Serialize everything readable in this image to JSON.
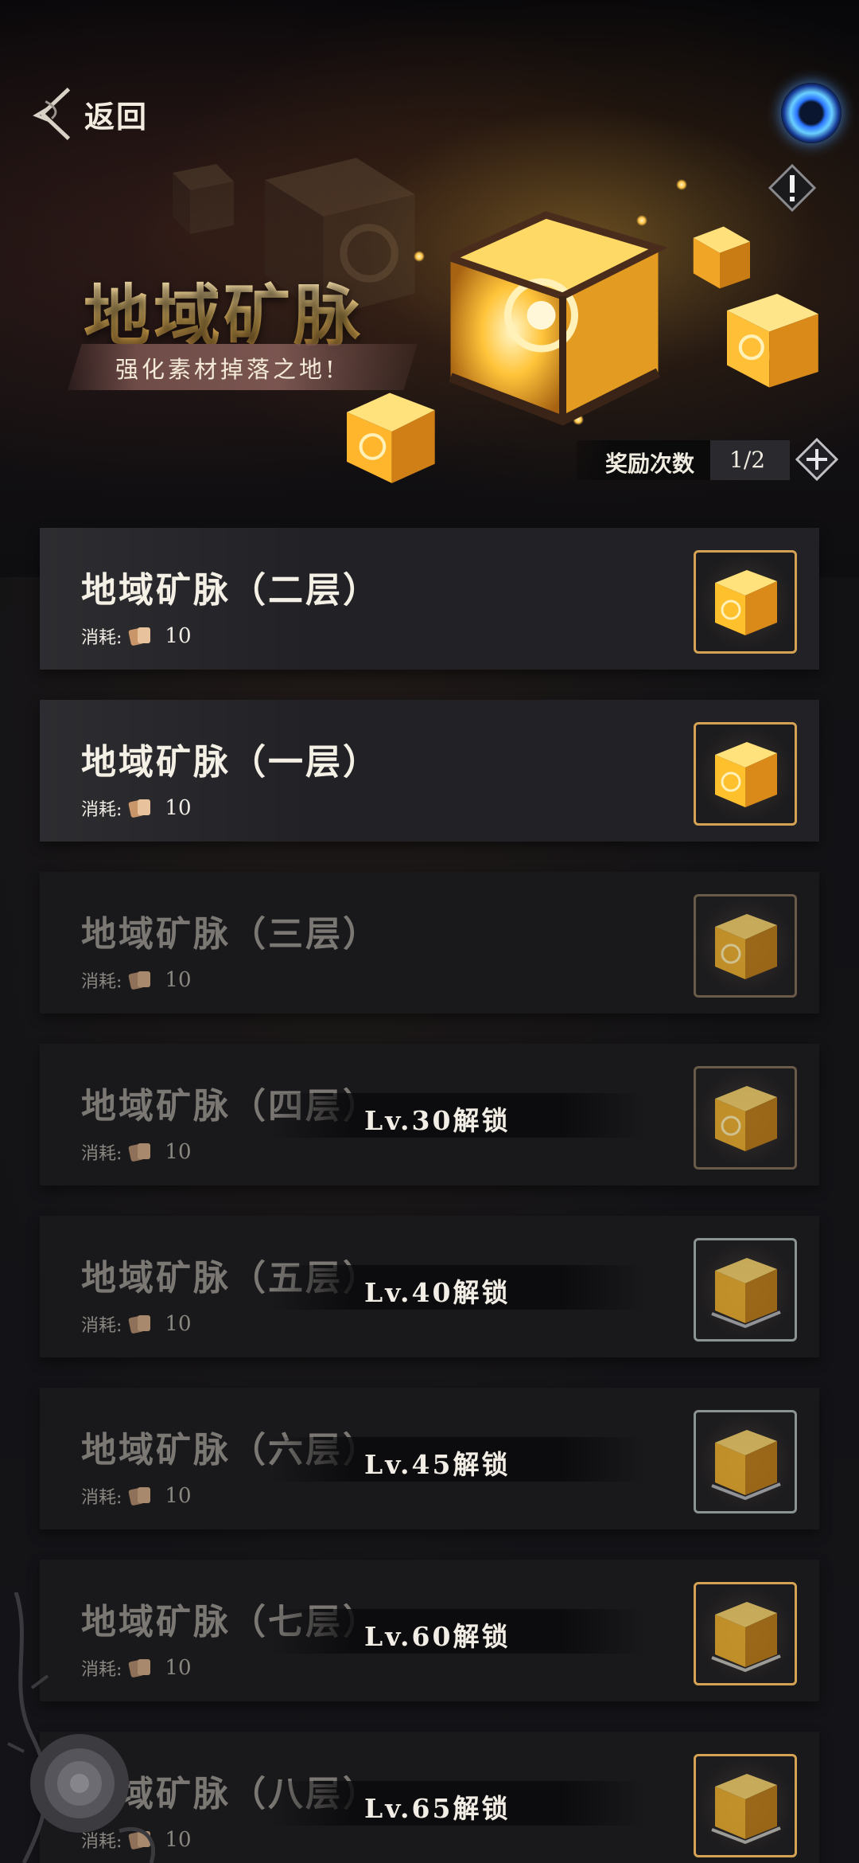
{
  "header": {
    "back_label": "返回",
    "title": "地域矿脉",
    "subtitle": "强化素材掉落之地!"
  },
  "reward": {
    "label": "奖励次数",
    "value": "1/2"
  },
  "colors": {
    "gold_text": "#e2b45a",
    "card_bg": "#1f1f23",
    "frame_gold": "#c79661",
    "page_bg": "#111114"
  },
  "dungeons": [
    {
      "name": "地域矿脉（二层）",
      "cost_label": "消耗:",
      "cost_value": "10",
      "lock_text": ""
    },
    {
      "name": "地域矿脉（一层）",
      "cost_label": "消耗:",
      "cost_value": "10",
      "lock_text": ""
    },
    {
      "name": "地域矿脉（三层）",
      "cost_label": "消耗:",
      "cost_value": "10",
      "lock_text": ""
    },
    {
      "name": "地域矿脉（四层）",
      "cost_label": "消耗:",
      "cost_value": "10",
      "lock_text": "Lv.30解锁"
    },
    {
      "name": "地域矿脉（五层）",
      "cost_label": "消耗:",
      "cost_value": "10",
      "lock_text": "Lv.40解锁"
    },
    {
      "name": "地域矿脉（六层）",
      "cost_label": "消耗:",
      "cost_value": "10",
      "lock_text": "Lv.45解锁"
    },
    {
      "name": "地域矿脉（七层）",
      "cost_label": "消耗:",
      "cost_value": "10",
      "lock_text": "Lv.60解锁"
    },
    {
      "name": "地域矿脉（八层）",
      "cost_label": "消耗:",
      "cost_value": "10",
      "lock_text": "Lv.65解锁"
    }
  ],
  "icons": {
    "back": "back-arrow-icon",
    "portal": "portal-icon",
    "info": "info-icon",
    "plus": "plus-icon",
    "cost": "stamina-cards-icon",
    "reward": "gold-cube-icon"
  }
}
